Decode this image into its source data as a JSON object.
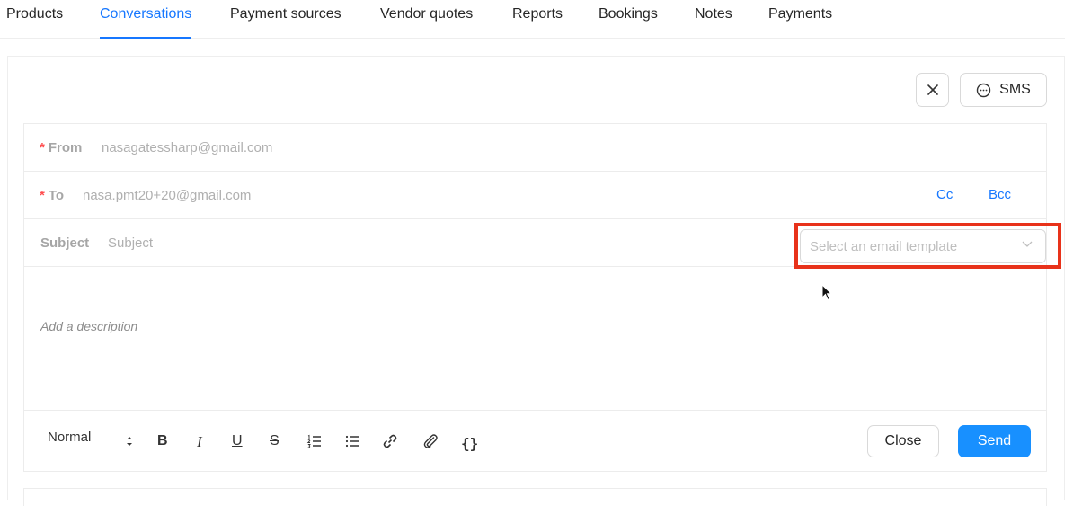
{
  "tabs": [
    {
      "label": "Products",
      "active": false
    },
    {
      "label": "Conversations",
      "active": true
    },
    {
      "label": "Payment sources",
      "active": false
    },
    {
      "label": "Vendor quotes",
      "active": false
    },
    {
      "label": "Reports",
      "active": false
    },
    {
      "label": "Bookings",
      "active": false
    },
    {
      "label": "Notes",
      "active": false
    },
    {
      "label": "Payments",
      "active": false
    }
  ],
  "header_actions": {
    "close_icon": "close-icon",
    "sms_label": "SMS",
    "sms_icon": "chat-bubble-icon"
  },
  "compose": {
    "from_label": "From",
    "from_value": "nasagatessharp@gmail.com",
    "required_marker": "*",
    "to_label": "To",
    "to_value": "nasa.pmt20+20@gmail.com",
    "cc_label": "Cc",
    "bcc_label": "Bcc",
    "subject_label": "Subject",
    "subject_placeholder": "Subject",
    "template_placeholder": "Select an email template",
    "description_placeholder": "Add a description"
  },
  "toolbar": {
    "heading_select": "Normal",
    "bold": "B",
    "italic": "I",
    "underline": "U",
    "strike": "S",
    "variables": "{}"
  },
  "footer": {
    "close_label": "Close",
    "send_label": "Send"
  },
  "colors": {
    "accent": "#1677ff",
    "send_bg": "#1890ff",
    "required": "#ff4d4f",
    "highlight": "#e8321a"
  }
}
